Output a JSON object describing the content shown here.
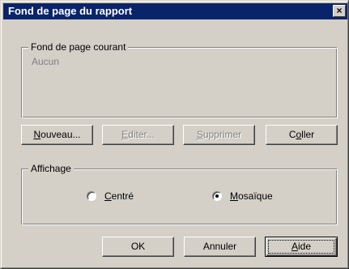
{
  "window": {
    "title": "Fond de page du rapport",
    "close_glyph": "×"
  },
  "current_group": {
    "legend": "Fond de page courant",
    "value": "Aucun"
  },
  "action_buttons": {
    "nouveau": {
      "pre": "",
      "u": "N",
      "post": "ouveau...",
      "enabled": true
    },
    "editer": {
      "pre": "",
      "u": "E",
      "post": "diter...",
      "enabled": false
    },
    "supprimer": {
      "pre": "",
      "u": "S",
      "post": "upprimer",
      "enabled": false
    },
    "coller": {
      "pre": "C",
      "u": "o",
      "post": "ller",
      "enabled": true
    }
  },
  "display_group": {
    "legend": "Affichage",
    "options": {
      "centre": {
        "pre": "",
        "u": "C",
        "post": "entré",
        "selected": false
      },
      "mosaique": {
        "pre": "",
        "u": "M",
        "post": "osaïque",
        "selected": true
      }
    }
  },
  "footer_buttons": {
    "ok": {
      "label": "OK"
    },
    "annuler": {
      "label": "Annuler"
    },
    "aide": {
      "pre": "",
      "u": "A",
      "post": "ide",
      "default": true
    }
  },
  "icons": {
    "close": "close-icon"
  }
}
